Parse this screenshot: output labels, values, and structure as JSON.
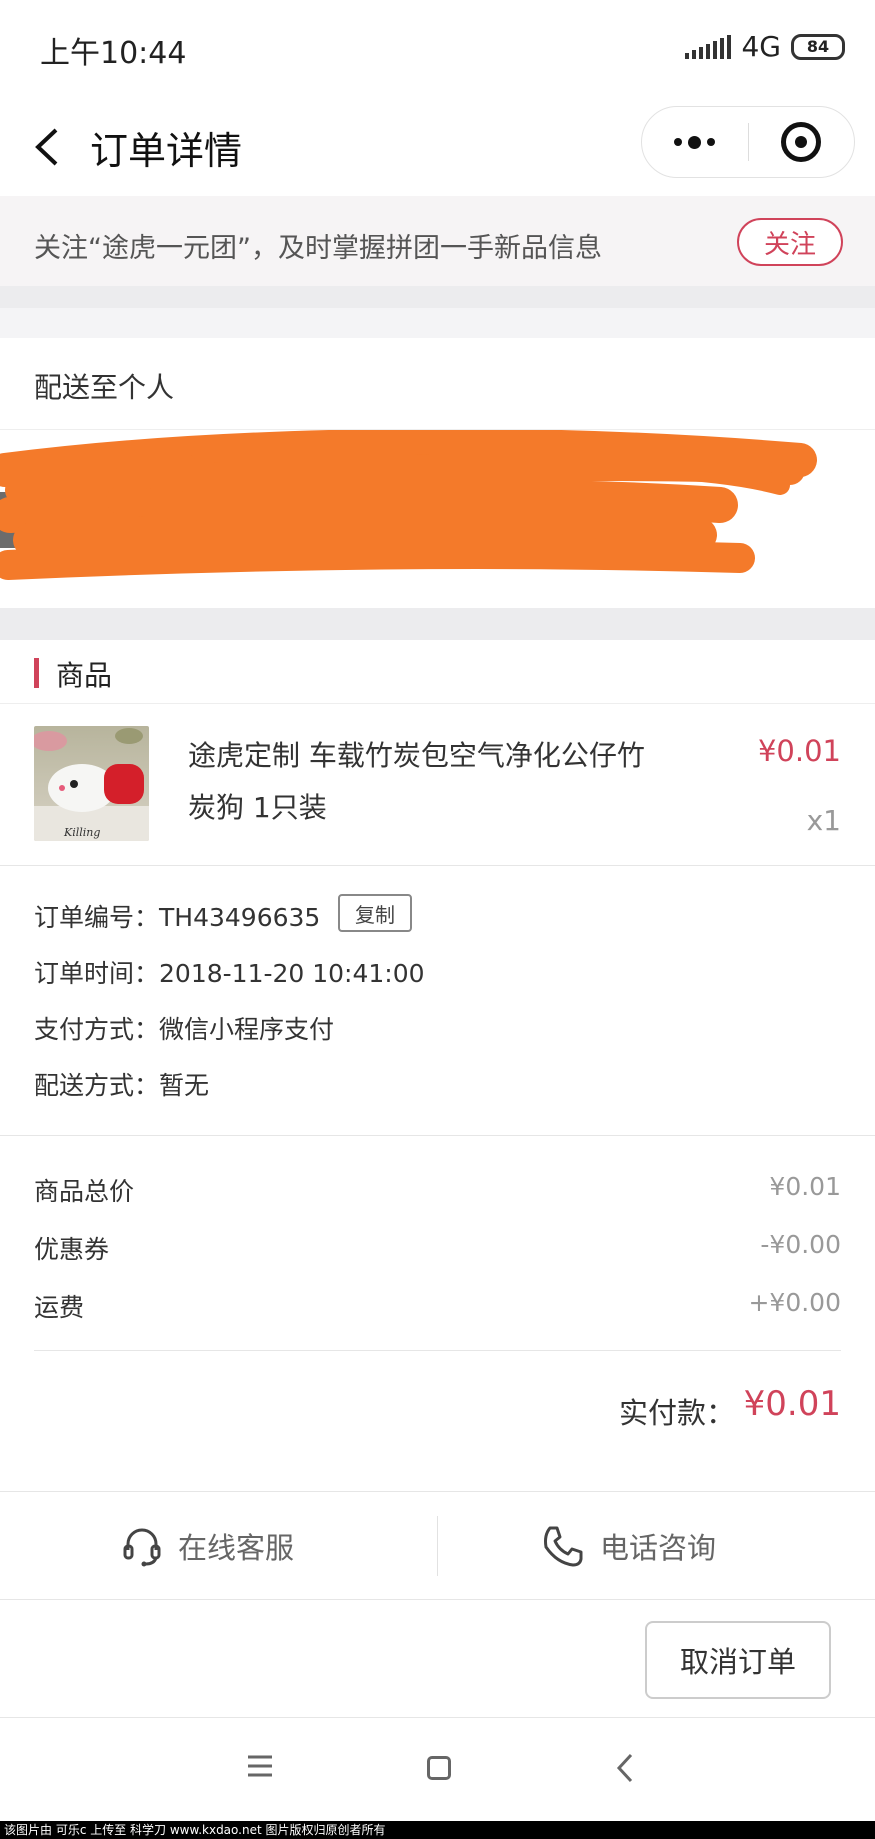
{
  "status_bar": {
    "time": "上午10:44",
    "network": "4G",
    "battery": "84"
  },
  "nav": {
    "title": "订单详情"
  },
  "banner": {
    "text": "关注“途虎一元团”，及时掌握拼团一手新品信息",
    "button": "关注"
  },
  "delivery": {
    "label": "配送至个人"
  },
  "goods_section": {
    "title": "商品"
  },
  "product": {
    "name": "途虎定制 车载竹炭包空气净化公仔竹炭狗 1只装",
    "price": "¥0.01",
    "quantity": "x1",
    "thumb_caption": "Killing"
  },
  "order": {
    "number_label": "订单编号：",
    "number": "TH43496635",
    "copy_button": "复制",
    "time_label": "订单时间：",
    "time": "2018-11-20 10:41:00",
    "payment_label": "支付方式：",
    "payment": "微信小程序支付",
    "shipping_label": "配送方式：",
    "shipping": "暂无"
  },
  "totals": {
    "subtotal_label": "商品总价",
    "subtotal": "¥0.01",
    "coupon_label": "优惠券",
    "coupon": "-¥0.00",
    "freight_label": "运费",
    "freight": "+¥0.00",
    "paid_label": "实付款：",
    "paid": "¥0.01"
  },
  "service": {
    "online": "在线客服",
    "phone": "电话咨询"
  },
  "actions": {
    "cancel": "取消订单"
  },
  "watermark": "该图片由 可乐c 上传至 科学刀 www.kxdao.net 图片版权归原创者所有",
  "colors": {
    "accent": "#d0435a",
    "scribble": "#f47a2a"
  }
}
